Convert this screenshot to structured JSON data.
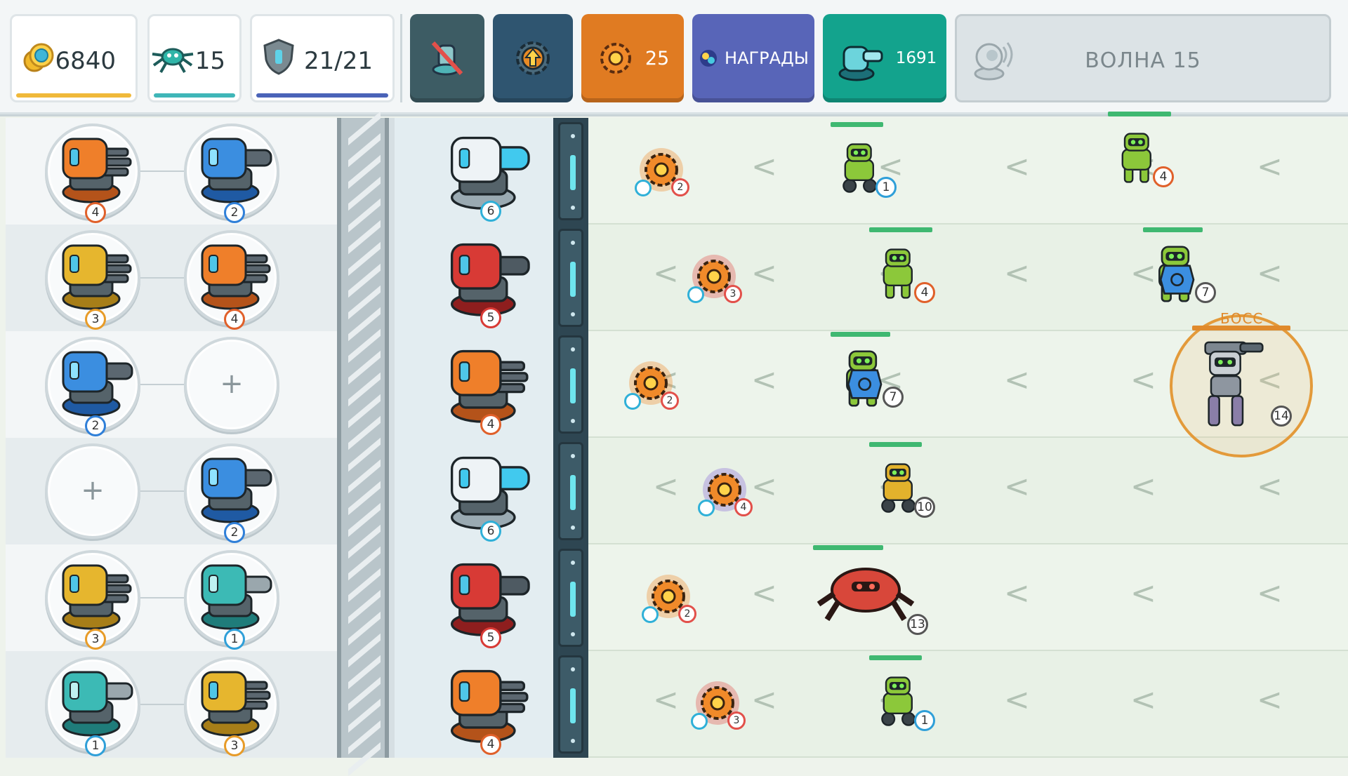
{
  "hud": {
    "coins": "6840",
    "enemies": "15",
    "shield": "21/21",
    "upgrade_points": "25",
    "rewards_label": "НАГРАДЫ",
    "turret_cost": "1691",
    "wave_label": "ВОЛНА 15",
    "colors": {
      "coins_bar": "#f0b93a",
      "enemies_bar": "#3fb6b8",
      "shield_bar": "#4a63b8",
      "btn_disabled": "#3d5c64",
      "btn_upgrade": "#2f5570",
      "btn_points": "#e07b22",
      "btn_rewards": "#5865b8",
      "btn_turret": "#13a38d"
    }
  },
  "inventory": {
    "rows": [
      {
        "left": {
          "type": "orange",
          "level": "4"
        },
        "right": {
          "type": "blue",
          "level": "2"
        }
      },
      {
        "left": {
          "type": "yellow",
          "level": "3"
        },
        "right": {
          "type": "orange",
          "level": "4"
        }
      },
      {
        "left": {
          "type": "blue",
          "level": "2"
        },
        "right": {
          "type": "empty",
          "label": "+"
        }
      },
      {
        "left": {
          "type": "empty",
          "label": "+"
        },
        "right": {
          "type": "blue",
          "level": "2"
        }
      },
      {
        "left": {
          "type": "yellow",
          "level": "3"
        },
        "right": {
          "type": "teal",
          "level": "1"
        }
      },
      {
        "left": {
          "type": "teal",
          "level": "1"
        },
        "right": {
          "type": "yellow",
          "level": "3"
        }
      }
    ]
  },
  "active_turrets": [
    {
      "type": "white",
      "level": "6"
    },
    {
      "type": "red",
      "level": "5"
    },
    {
      "type": "orange",
      "level": "4"
    },
    {
      "type": "white",
      "level": "6"
    },
    {
      "type": "red",
      "level": "5"
    },
    {
      "type": "orange",
      "level": "4"
    }
  ],
  "lanes": [
    {
      "mines": [
        {
          "level": "2",
          "variant": "orange"
        }
      ],
      "enemies": [
        {
          "kind": "small-robot",
          "level": "1"
        },
        {
          "kind": "walker",
          "level": "4"
        }
      ]
    },
    {
      "mines": [
        {
          "level": "3",
          "variant": "red"
        }
      ],
      "enemies": [
        {
          "kind": "walker",
          "level": "4"
        },
        {
          "kind": "shield-robot",
          "level": "7"
        }
      ]
    },
    {
      "mines": [
        {
          "level": "2",
          "variant": "orange"
        }
      ],
      "enemies": [
        {
          "kind": "shield-robot",
          "level": "7"
        },
        {
          "kind": "boss",
          "level": "14",
          "label": "БОСС"
        }
      ]
    },
    {
      "mines": [
        {
          "level": "4",
          "variant": "purple"
        }
      ],
      "enemies": [
        {
          "kind": "yellow-robot",
          "level": "10"
        }
      ]
    },
    {
      "mines": [
        {
          "level": "2",
          "variant": "orange"
        }
      ],
      "enemies": [
        {
          "kind": "crab",
          "level": "13"
        }
      ]
    },
    {
      "mines": [
        {
          "level": "3",
          "variant": "red"
        }
      ],
      "enemies": [
        {
          "kind": "small-robot",
          "level": "1"
        }
      ]
    }
  ],
  "chevron": "<"
}
